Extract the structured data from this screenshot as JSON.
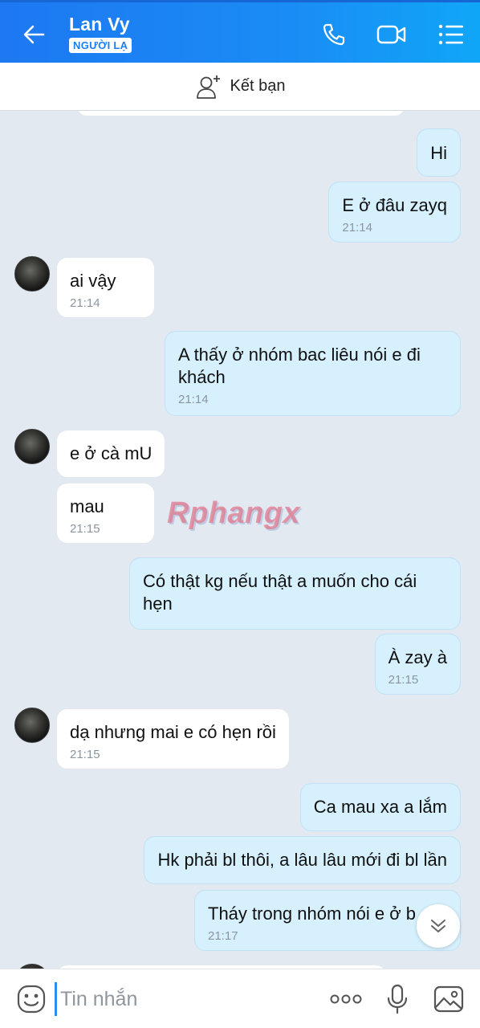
{
  "header": {
    "contact_name": "Lan Vy",
    "badge": "NGƯỜI LẠ",
    "icons": [
      "back-arrow-icon",
      "phone-icon",
      "video-call-icon",
      "menu-icon"
    ]
  },
  "friend_bar": {
    "label": "Kết bạn",
    "icon": "add-friend-icon"
  },
  "messages": [
    {
      "dir": "out",
      "text": "Hi",
      "time": ""
    },
    {
      "dir": "out",
      "text": "E ở đâu zayq",
      "time": "21:14"
    },
    {
      "dir": "in",
      "text": "ai vậy",
      "time": "21:14"
    },
    {
      "dir": "out",
      "text": "A thấy ở nhóm bac liêu nói e đi khách",
      "time": "21:14"
    },
    {
      "dir": "in",
      "text": "e ở cà mU",
      "time": ""
    },
    {
      "dir": "in",
      "text": "mau",
      "time": "21:15"
    },
    {
      "dir": "out",
      "text": "Có thật kg nếu thật a muốn cho cái hẹn",
      "time": ""
    },
    {
      "dir": "out",
      "text": "À zay à",
      "time": "21:15"
    },
    {
      "dir": "in",
      "text": "dạ nhưng mai e có hẹn rồi",
      "time": "21:15"
    },
    {
      "dir": "out",
      "text": "Ca mau xa a lắm",
      "time": ""
    },
    {
      "dir": "out",
      "text": "Hk phải bl thôi, a lâu lâu mới đi bl lần",
      "time": ""
    },
    {
      "dir": "out",
      "text": "Tháy trong nhóm nói e ở b",
      "time": "21:17"
    }
  ],
  "watermark": "Rphangx",
  "composer": {
    "placeholder": "Tin nhắn",
    "icons": [
      "emoji-icon",
      "more-icon",
      "microphone-icon",
      "image-icon"
    ]
  },
  "colors": {
    "header": "#1a80f3",
    "outgoing_bubble": "#d6f0fd",
    "incoming_bubble": "#ffffff",
    "chat_bg": "#e2e9f1"
  }
}
